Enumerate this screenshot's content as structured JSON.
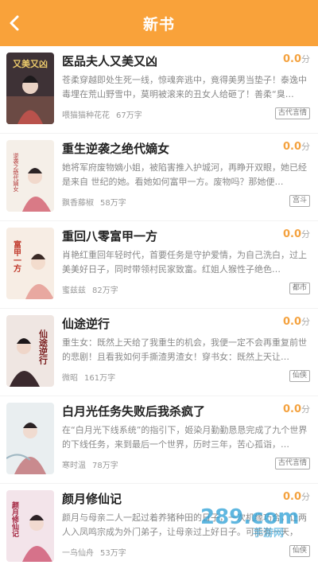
{
  "header": {
    "title": "新书"
  },
  "books": [
    {
      "title": "医品夫人又美又凶",
      "score": "0.0",
      "score_unit": "分",
      "desc": "苍柔穿越即处生死一线，惊魂奔逃中，竟得美男当垫子！泰逸中毒埋在荒山野雪中，莫明被滚来的丑女人给砸了！善柔“臭…",
      "author": "喂猫猫种花花",
      "word_count": "67万字",
      "tag": "古代言情",
      "cover_text": "又美又凶",
      "cover_bg": "#4a3a3c"
    },
    {
      "title": "重生逆袭之绝代嫡女",
      "score": "0.0",
      "score_unit": "分",
      "desc": "她将军府废物嫡小姐，被陷害推入护城河，再睁开双眼，她已经是来自 世纪的她。看她如何富甲一方。废物吗？那她便…",
      "author": "飘香藤椒",
      "word_count": "58万字",
      "tag": "宫斗",
      "cover_text": "逆袭之绝代嫡女",
      "cover_bg": "#f5efe8"
    },
    {
      "title": "重回八零富甲一方",
      "score": "0.0",
      "score_unit": "分",
      "desc": "肖艳红重回年轻时代，首要任务是守护爱情，为自己洗白，过上美美好日子，同时带领村民家致富。红姐人猴性子绝色…",
      "author": "蜜兹兹",
      "word_count": "82万字",
      "tag": "都市",
      "cover_text": "富甲一方",
      "cover_bg": "#f7ede4"
    },
    {
      "title": "仙途逆行",
      "score": "0.0",
      "score_unit": "分",
      "desc": "重生女：既然上天给了我重生的机会，我便一定不会再重复前世的悲剧！且看我如何手撕渣男渣女！穿书女：既然上天让…",
      "author": "微昭",
      "word_count": "161万字",
      "tag": "仙侠",
      "cover_text": "仙途逆行",
      "cover_bg": "#efe6e2"
    },
    {
      "title": "白月光任务失败后我杀疯了",
      "score": "0.0",
      "score_unit": "分",
      "desc": "在“白月光下线系统”的指引下，姬染月勤勤恳恳完成了九个世界的下线任务，来到最后一个世界，历时三年，苦心孤诣，…",
      "author": "寒时温",
      "word_count": "78万字",
      "tag": "古代言情",
      "cover_text": "",
      "cover_bg": "#e9eef0"
    },
    {
      "title": "颜月修仙记",
      "score": "0.0",
      "score_unit": "分",
      "desc": "颜月与母亲二人一起过着养猪种田的日子，一次机缘巧合，让两人入凤鸣宗成为外门弟子，让母亲过上好日子。可能有一天，她…",
      "author": "一鸟仙舟",
      "word_count": "53万字",
      "tag": "仙侠",
      "cover_text": "颜月修仙记",
      "cover_bg": "#f3e4ea"
    }
  ],
  "watermark": {
    "text": "289.com",
    "sub": "手游网"
  },
  "colors": {
    "accent": "#f9a23a",
    "score": "#f4a23f"
  }
}
